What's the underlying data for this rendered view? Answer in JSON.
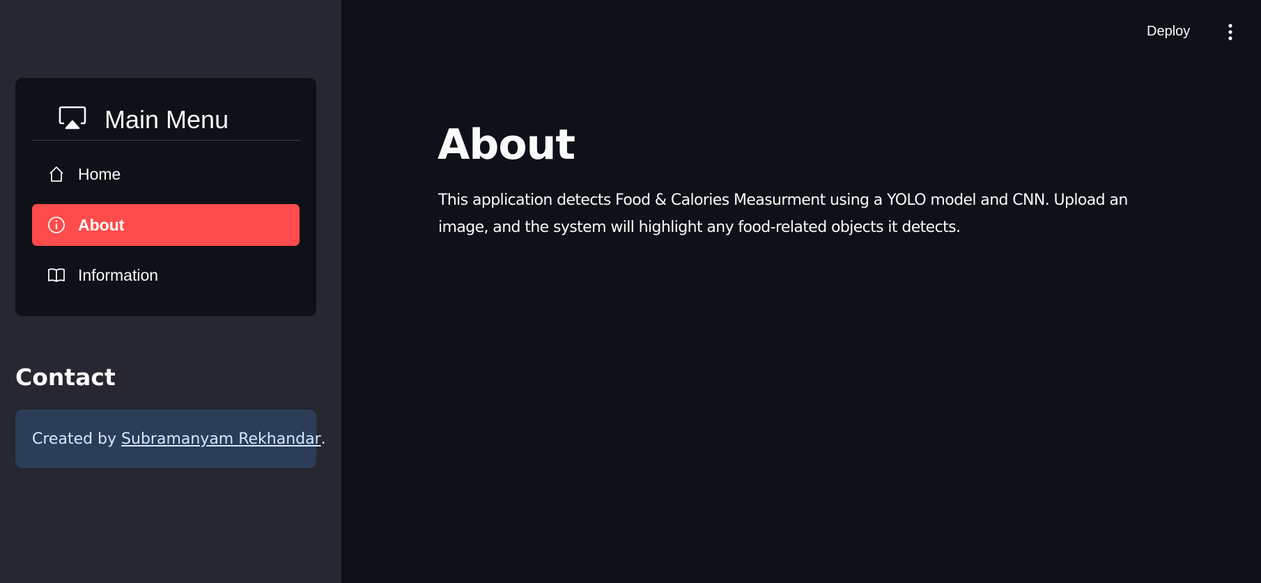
{
  "topbar": {
    "deploy_label": "Deploy",
    "menu_icon": "more-vertical-icon"
  },
  "sidebar": {
    "menu_title": "Main Menu",
    "menu_icon": "cast-icon",
    "items": [
      {
        "label": "Home",
        "icon": "house-icon",
        "active": false
      },
      {
        "label": "About",
        "icon": "info-circle-icon",
        "active": true
      },
      {
        "label": "Information",
        "icon": "book-icon",
        "active": false
      }
    ],
    "contact": {
      "title": "Contact",
      "prefix": "Created by ",
      "link_text": "Subramanyam Rekhandar",
      "suffix": "."
    }
  },
  "main": {
    "title": "About",
    "body": "This application detects Food & Calories Measurment using a YOLO model and CNN. Upload an image, and the system will highlight any food-related objects it detects."
  },
  "colors": {
    "active_bg": "#ff4b4b",
    "main_bg": "#0e1117",
    "sidebar_bg": "#262730",
    "contact_bg": "#2b3d57"
  }
}
